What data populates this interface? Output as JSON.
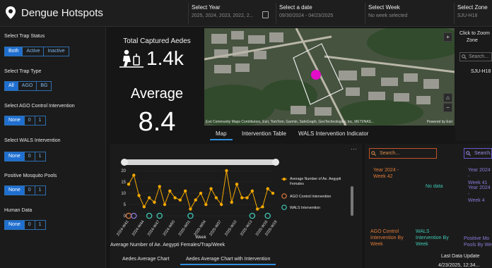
{
  "header": {
    "title": "Dengue Hotspots",
    "select_year_label": "Select Year",
    "select_year_value": "2025, 2024, 2023, 2022, 2...",
    "select_date_label": "Select a date",
    "select_date_value": "09/30/2024 - 04/23/2025",
    "select_week_label": "Select Week",
    "select_week_value": "No week selected",
    "select_zone_label": "Select Zone",
    "select_zone_value": "SJU-H18"
  },
  "filters": {
    "trap_status": {
      "title": "Select Trap Status",
      "options": [
        "Both",
        "Active",
        "Inactive"
      ],
      "selected": "Both"
    },
    "trap_type": {
      "title": "Select Trap Type",
      "options": [
        "All",
        "AGO",
        "BG"
      ],
      "selected": "All"
    },
    "ago": {
      "title": "Select AGO Control Intervention",
      "options": [
        "None",
        "0",
        "1"
      ],
      "selected": "None"
    },
    "wals": {
      "title": "Select WALS Intervention",
      "options": [
        "None",
        "0",
        "1"
      ],
      "selected": "None"
    },
    "pools": {
      "title": "Positive Mosquito Pools",
      "options": [
        "None",
        "0",
        "1"
      ],
      "selected": "None"
    },
    "human": {
      "title": "Human Data",
      "options": [
        "None",
        "0",
        "1"
      ],
      "selected": "None"
    }
  },
  "stats": {
    "captured_title": "Total Captured Aedes",
    "captured_value": "1.4k",
    "average_label": "Average",
    "average_value": "8.4"
  },
  "map": {
    "attribution": "Esri Community Maps Contributors, Esri, TomTom, Garmin, SafeGraph, GeoTechnologies, Inc, METI/NAS...",
    "powered": "Powered by Esri",
    "tabs": [
      "Map",
      "Intervention Table",
      "WALS Intervention Indicator"
    ],
    "active_tab": "Map"
  },
  "zone_panel": {
    "click_text": "Click to Zoom",
    "zone_text": "Zone",
    "search_placeholder": "Search...",
    "zone_item": "SJU-H18"
  },
  "chart_footer": "Average Number of Ae. Aegypti Females/Trap/Week",
  "chart_tabs": [
    "Aedes Average Chart",
    "Aedes Average Chart with Intervention"
  ],
  "chart_tab_active": "Aedes Average Chart with Intervention",
  "list_panel": {
    "search1": "Search...",
    "search2": "Search...",
    "week_item1": "Year 2024 -\nWeek 42",
    "no_data": "No data",
    "week_item2a": "Year 2024 -\nWeek 41",
    "week_item2b": "Year 2024 -\nWeek 4",
    "col_ago": "AGO Control\nIntervention By\nWeek",
    "col_wals": "WALS\nIntervention By\nWeek",
    "col_pos": "Positive Mo\nPools By We",
    "last_update_label": "Last Data Update",
    "last_update_value": "4/23/2025, 12:34..."
  },
  "colors": {
    "accent": "#2f8fe0",
    "series_orange": "#f5a800",
    "ago_circle": "#e07b39",
    "wals_circle": "#3fc7b4",
    "extra_circle": "#8a7bd8",
    "map_marker": "#e40ec8"
  },
  "chart_data": {
    "type": "line",
    "title": "",
    "xlabel": "Week",
    "ylabel": "",
    "ylim": [
      0,
      20
    ],
    "yticks": [
      0,
      5,
      10,
      15,
      20
    ],
    "x": [
      "2024-W41",
      "2024-W42",
      "2024-W43",
      "2024-W44",
      "2024-W45",
      "2024-W46",
      "2024-W47",
      "2024-W48",
      "2024-W49",
      "2024-W50",
      "2024-W51",
      "2024-W52",
      "2025-W01",
      "2025-W02",
      "2025-W03",
      "2025-W04",
      "2025-W05",
      "2025-W06",
      "2025-W07",
      "2025-W08",
      "2025-W09",
      "2025-W10",
      "2025-W11",
      "2025-W12",
      "2025-W13",
      "2025-W14",
      "2025-W15",
      "2025-W16",
      "2025-W17"
    ],
    "xtick_labels": [
      "2024-W41",
      "2024-W44",
      "2024-W47",
      "2024-W50",
      "2025-W01",
      "2025-W04",
      "2025-W07",
      "2025-W10",
      "2025-W13",
      "2025-W16",
      "2025-W19"
    ],
    "series": [
      {
        "name": "Average Number of Ae. Aegypti Females",
        "values": [
          14,
          18,
          9,
          4,
          8,
          6,
          13,
          5,
          11,
          8,
          7,
          11,
          3,
          7,
          10,
          5,
          12,
          8,
          5,
          20,
          6,
          14,
          8,
          8,
          11,
          3,
          4,
          12,
          10
        ]
      }
    ],
    "legend": [
      "Average Number of Ae. Aegypti Females",
      "AGO Control Intervention",
      "WALS Intervention"
    ],
    "legend_position": "right",
    "intervention_markers": {
      "ago": [
        "2024-W41"
      ],
      "wals": [
        "2024-W45",
        "2024-W47",
        "2025-W01",
        "2025-W13",
        "2025-W16"
      ],
      "other": [
        "2024-W42"
      ]
    }
  }
}
